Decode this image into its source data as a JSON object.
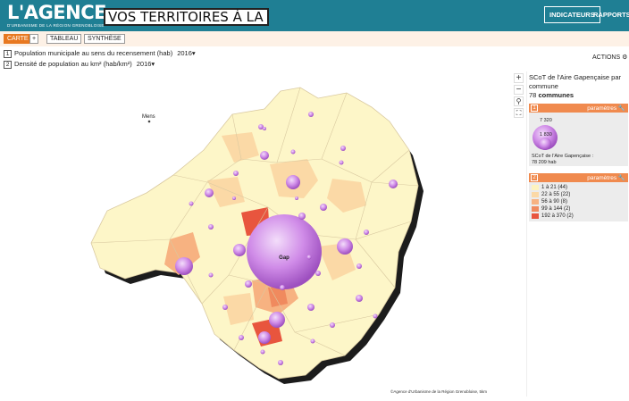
{
  "header": {
    "logo_brand": "L'AGENCE",
    "logo_sub": "D'URBANISME DE LA RÉGION GRENOBLOISE",
    "title": "VOS TERRITOIRES À LA CARTE",
    "btn_indicateurs": "INDICATEURS",
    "btn_rapports": "RAPPORTS",
    "color": "#1f7f94"
  },
  "toolbar": {
    "carte": "CARTE",
    "plus": "+",
    "tableau": "TABLEAU",
    "synthese": "SYNTHÈSE",
    "accent": "#e8781f"
  },
  "indicators": [
    {
      "num": "1",
      "label": "Population municipale au sens du recensement (hab)",
      "year": "2016"
    },
    {
      "num": "2",
      "label": "Densité de population au km² (hab/km²)",
      "year": "2016"
    }
  ],
  "actions": "ACTIONS",
  "map": {
    "city_mens": "Mens",
    "city_gap": "Gap",
    "zoom_in": "+",
    "zoom_out": "−",
    "attribution": "©Agence d'Urbanisme de la Région Grenobloise, 5km"
  },
  "legend": {
    "title": "SCoT de l'Aire Gapençaise par commune",
    "count_num": "78",
    "count_label": "communes",
    "param_label": "paramètres",
    "num1": "1",
    "num2": "2",
    "circle_max": "7 320",
    "circle_mid": "1 830",
    "circle_note": "SCoT de l'Aire Gapençaise :",
    "circle_total": "78 209 hab",
    "classes": [
      {
        "label": "1 à 21 (44)",
        "color": "#fdf3c0"
      },
      {
        "label": "22 à 55 (22)",
        "color": "#fbd9a6"
      },
      {
        "label": "56 à 90 (8)",
        "color": "#f7b281"
      },
      {
        "label": "99 à 144 (2)",
        "color": "#f08a5e"
      },
      {
        "label": "192 à 370 (2)",
        "color": "#e8553e"
      }
    ],
    "bubble_color": "#c77be0"
  }
}
